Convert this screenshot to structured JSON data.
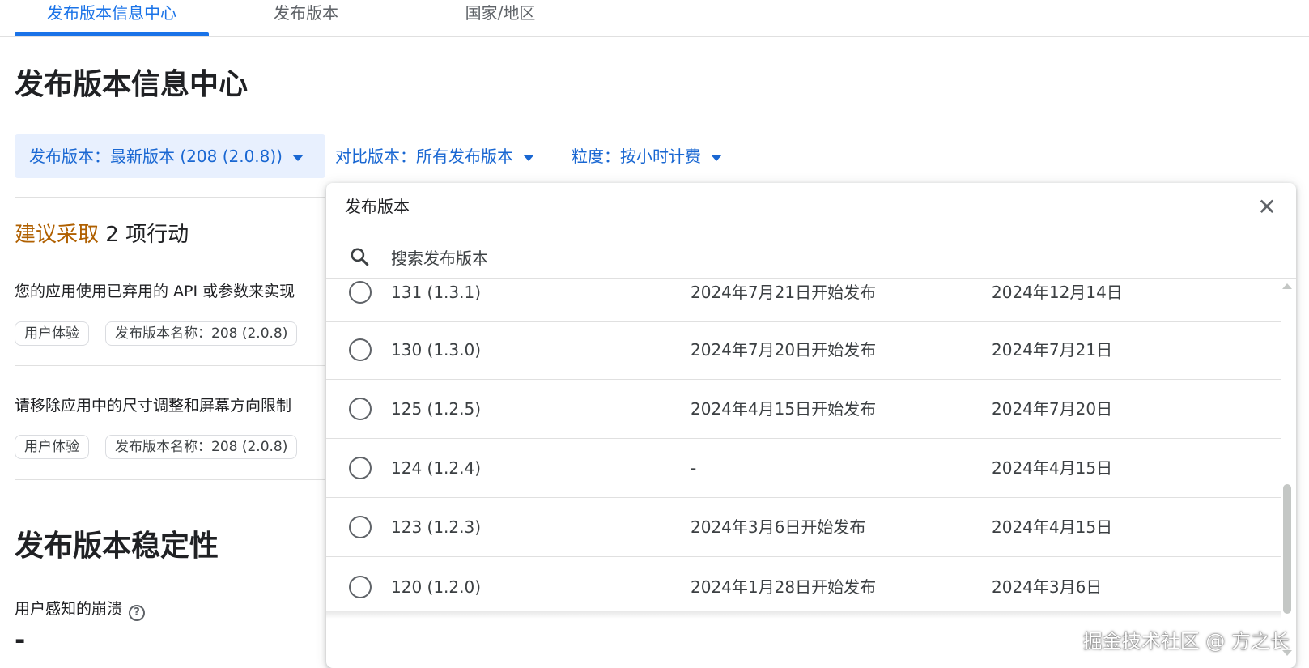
{
  "tabs": [
    {
      "label": "发布版本信息中心",
      "active": true
    },
    {
      "label": "发布版本",
      "active": false
    },
    {
      "label": "国家/地区",
      "active": false
    }
  ],
  "page_title": "发布版本信息中心",
  "filters": {
    "release": "发布版本：最新版本 (208 (2.0.8))",
    "compare": "对比版本：所有发布版本",
    "granularity": "粒度：按小时计费"
  },
  "recommendations": {
    "highlight": "建议采取",
    "rest": " 2 项行动",
    "items": [
      {
        "text": "您的应用使用已弃用的 API 或参数来实现",
        "tags": [
          "用户体验",
          "发布版本名称：208 (2.0.8)"
        ]
      },
      {
        "text": "请移除应用中的尺寸调整和屏幕方向限制",
        "tags": [
          "用户体验",
          "发布版本名称：208 (2.0.8)"
        ]
      }
    ]
  },
  "stability": {
    "title": "发布版本稳定性",
    "crash_label": "用户感知的崩溃",
    "help_glyph": "?",
    "crash_value": "-"
  },
  "panel": {
    "title": "发布版本",
    "close_glyph": "✕",
    "search_placeholder": "搜索发布版本",
    "releases": [
      {
        "version": "131 (1.3.1)",
        "started": "2024年7月21日开始发布",
        "ended": "2024年12月14日"
      },
      {
        "version": "130 (1.3.0)",
        "started": "2024年7月20日开始发布",
        "ended": "2024年7月21日"
      },
      {
        "version": "125 (1.2.5)",
        "started": "2024年4月15日开始发布",
        "ended": "2024年7月20日"
      },
      {
        "version": "124 (1.2.4)",
        "started": "-",
        "ended": "2024年4月15日"
      },
      {
        "version": "123 (1.2.3)",
        "started": "2024年3月6日开始发布",
        "ended": "2024年4月15日"
      },
      {
        "version": "120 (1.2.0)",
        "started": "2024年1月28日开始发布",
        "ended": "2024年3月6日"
      }
    ]
  },
  "watermark": "掘金技术社区 @ 方之长",
  "colors": {
    "accent": "#1a73e8",
    "link": "#1967d2",
    "highlight": "#b06000",
    "chip_bg": "#e8f0fe"
  },
  "icons": [
    "caret-down-icon",
    "close-icon",
    "search-icon",
    "help-icon",
    "radio-icon"
  ]
}
